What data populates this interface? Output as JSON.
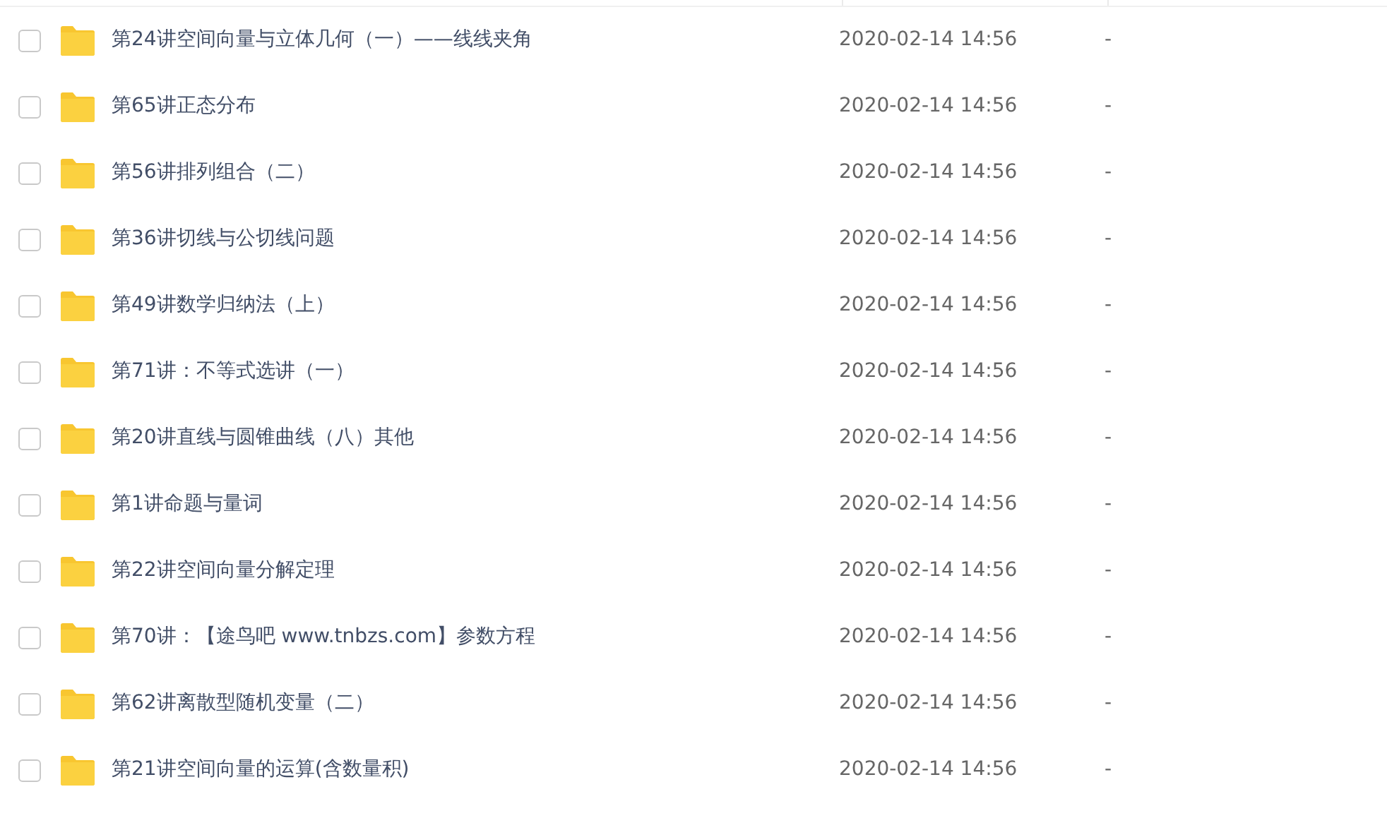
{
  "rows": [
    {
      "name": "第24讲空间向量与立体几何（一）——线线夹角",
      "modified": "2020-02-14 14:56",
      "size": "-",
      "checked": false
    },
    {
      "name": "第65讲正态分布",
      "modified": "2020-02-14 14:56",
      "size": "-",
      "checked": false
    },
    {
      "name": "第56讲排列组合（二）",
      "modified": "2020-02-14 14:56",
      "size": "-",
      "checked": false
    },
    {
      "name": "第36讲切线与公切线问题",
      "modified": "2020-02-14 14:56",
      "size": "-",
      "checked": false
    },
    {
      "name": "第49讲数学归纳法（上）",
      "modified": "2020-02-14 14:56",
      "size": "-",
      "checked": false
    },
    {
      "name": "第71讲：不等式选讲（一）",
      "modified": "2020-02-14 14:56",
      "size": "-",
      "checked": false
    },
    {
      "name": "第20讲直线与圆锥曲线（八）其他",
      "modified": "2020-02-14 14:56",
      "size": "-",
      "checked": false
    },
    {
      "name": "第1讲命题与量词",
      "modified": "2020-02-14 14:56",
      "size": "-",
      "checked": false
    },
    {
      "name": "第22讲空间向量分解定理",
      "modified": "2020-02-14 14:56",
      "size": "-",
      "checked": false
    },
    {
      "name": "第70讲：【途鸟吧 www.tnbzs.com】参数方程",
      "modified": "2020-02-14 14:56",
      "size": "-",
      "checked": false
    },
    {
      "name": "第62讲离散型随机变量（二）",
      "modified": "2020-02-14 14:56",
      "size": "-",
      "checked": false
    },
    {
      "name": "第21讲空间向量的运算(含数量积)",
      "modified": "2020-02-14 14:56",
      "size": "-",
      "checked": false
    }
  ]
}
